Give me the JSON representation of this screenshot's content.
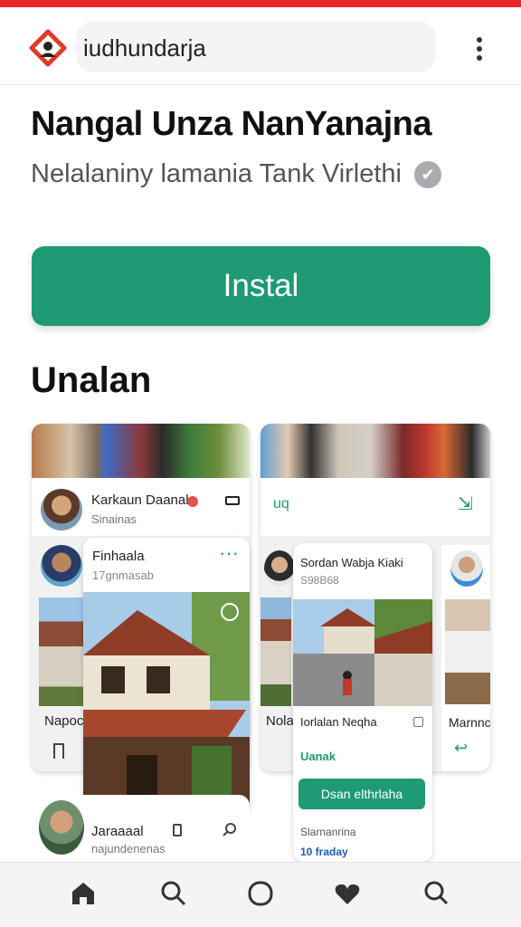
{
  "header": {
    "url": "iudhundarja"
  },
  "app": {
    "title": "Nangal Unza NanYanajna",
    "subtitle": "Nelalaniny lamania Tank Virlethi",
    "install_label": "Instal"
  },
  "section": {
    "heading": "Unalan"
  },
  "screenshots": {
    "left": {
      "top_card": {
        "name": "Karkaun Daanal",
        "sub": "Sinainas"
      },
      "mid_card": {
        "name": "Finhaala",
        "sub": "17gnmasab"
      },
      "bottom_left": "Napoc",
      "bottom_card": {
        "name": "Jaraaaal",
        "sub": "najundenenas"
      }
    },
    "right": {
      "header_label": "uq",
      "card": {
        "name": "Sordan Wabja Kiaki",
        "sub": "S98B68",
        "caption": "Iorlalan Neqha",
        "tag": "Uanak",
        "button": "Dsan elthrlaha",
        "meta": "Slarnanrina",
        "time": "10 fraday"
      },
      "left_label": "Nola",
      "right_label": "Marnnc"
    }
  },
  "bottom_nav": {
    "items": [
      "home-icon",
      "search-icon",
      "circle-icon",
      "heart-icon",
      "search-icon"
    ]
  },
  "colors": {
    "accent": "#1e9b74",
    "brand": "#e8232a"
  }
}
